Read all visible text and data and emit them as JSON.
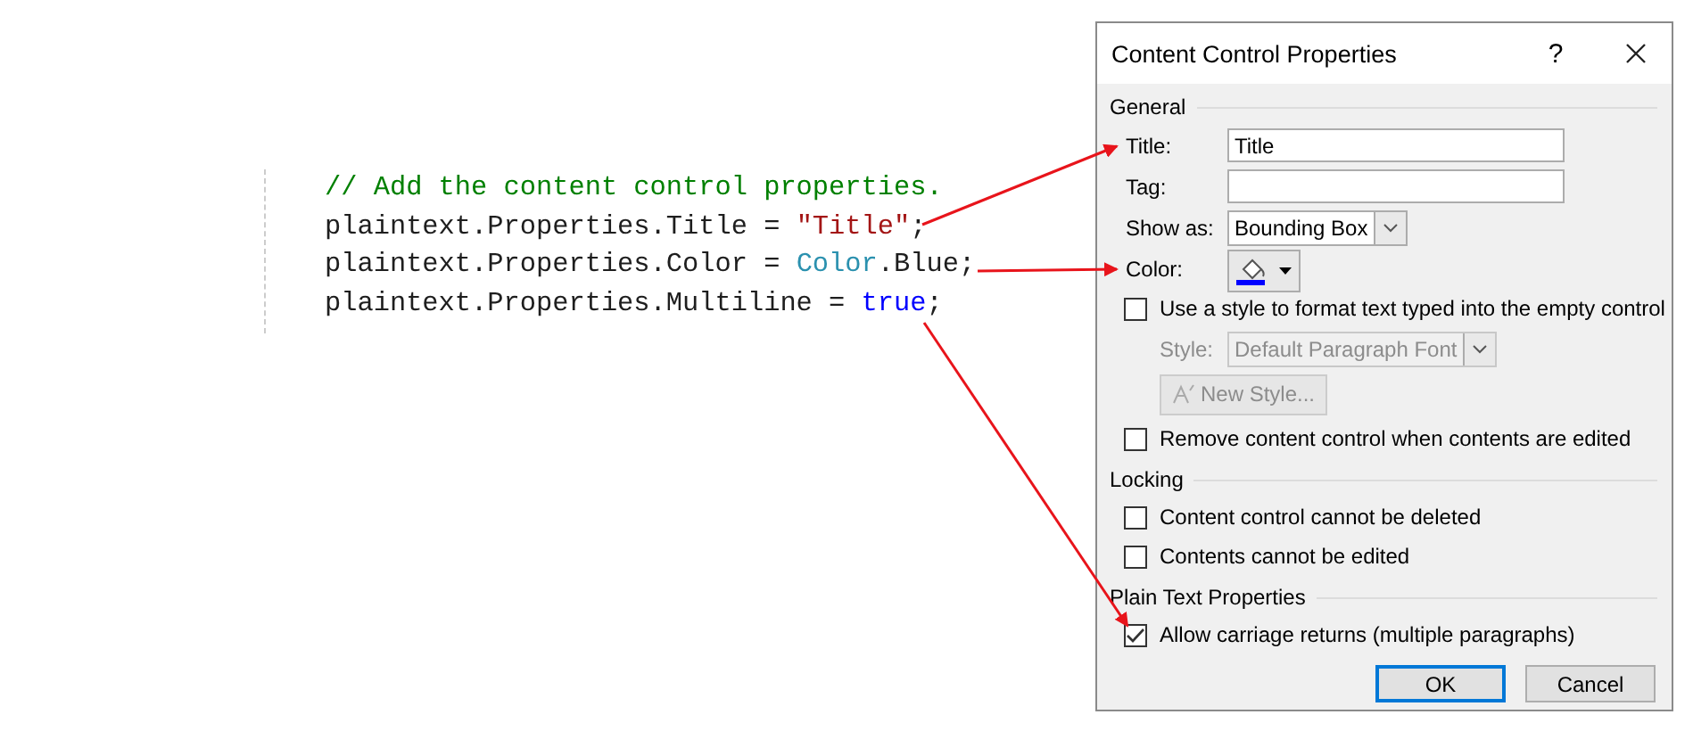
{
  "code": {
    "lines": [
      [
        {
          "kind": "comment",
          "text": "// Add the content control properties."
        }
      ],
      [
        {
          "kind": "plain",
          "text": "plaintext.Properties.Title = "
        },
        {
          "kind": "string",
          "text": "\"Title\""
        },
        {
          "kind": "plain",
          "text": ";"
        }
      ],
      [
        {
          "kind": "plain",
          "text": "plaintext.Properties.Color = "
        },
        {
          "kind": "type",
          "text": "Color"
        },
        {
          "kind": "plain",
          "text": ".Blue;"
        }
      ],
      [
        {
          "kind": "plain",
          "text": "plaintext.Properties.Multiline = "
        },
        {
          "kind": "keyword",
          "text": "true"
        },
        {
          "kind": "plain",
          "text": ";"
        }
      ]
    ]
  },
  "dialog": {
    "title": "Content Control Properties",
    "help": "?",
    "sections": [
      {
        "heading": "General",
        "items": [
          {
            "kind": "text_field",
            "label": "Title:",
            "value": "Title"
          },
          {
            "kind": "text_field",
            "label": "Tag:"
          },
          {
            "kind": "select",
            "label": "Show as:",
            "value": "Bounding Box",
            "disabled": false
          },
          {
            "kind": "color",
            "label": "Color:",
            "color": "#0000ff"
          },
          {
            "kind": "checkbox",
            "label": "Use a style to format text typed into the empty control",
            "checked": false,
            "children": [
              {
                "kind": "select",
                "label": "Style:",
                "value": "Default Paragraph Font",
                "disabled": true
              },
              {
                "kind": "button",
                "label": "New Style...",
                "disabled": true
              }
            ]
          },
          {
            "kind": "checkbox",
            "label": "Remove content control when contents are edited",
            "checked": false
          }
        ]
      },
      {
        "heading": "Locking",
        "items": [
          {
            "kind": "checkbox",
            "label": "Content control cannot be deleted",
            "checked": false
          },
          {
            "kind": "checkbox",
            "label": "Contents cannot be edited",
            "checked": false
          }
        ]
      },
      {
        "heading": "Plain Text Properties",
        "items": [
          {
            "kind": "checkbox",
            "label": "Allow carriage returns (multiple paragraphs)",
            "checked": true
          }
        ]
      }
    ],
    "buttons": [
      {
        "label": "OK",
        "default": true
      },
      {
        "label": "Cancel",
        "default": false
      }
    ]
  }
}
